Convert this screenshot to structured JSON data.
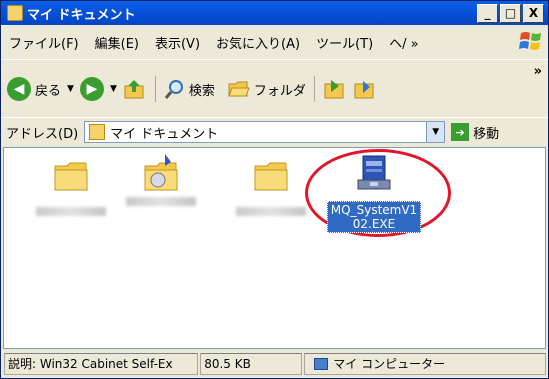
{
  "window": {
    "title": "マイ ドキュメント",
    "buttons": {
      "minimize": "_",
      "maximize": "□",
      "close": "X"
    }
  },
  "menu": [
    "ファイル(F)",
    "編集(E)",
    "表示(V)",
    "お気に入り(A)",
    "ツール(T)",
    "ヘ/ »"
  ],
  "toolbar": {
    "back": "戻る",
    "forward": "",
    "search": "検索",
    "folders": "フォルダ",
    "more": "»"
  },
  "address": {
    "label": "アドレス(D)",
    "value": "マイ ドキュメント",
    "go": "移動"
  },
  "files": [
    {
      "type": "folder"
    },
    {
      "type": "media-folder"
    },
    {
      "type": "folder"
    },
    {
      "type": "exe",
      "label": "MQ_SystemV1\n02.EXE",
      "label_line1": "MQ_SystemV1",
      "label_line2": "02.EXE"
    }
  ],
  "status": {
    "description": "説明: Win32 Cabinet Self-Ex",
    "size": "80.5 KB",
    "zone": "マイ コンピューター"
  },
  "colors": {
    "title_bar": "#0a5ee8",
    "selection": "#316ac5",
    "highlight_ring": "#e0172b",
    "back_button": "#3a9d2f"
  }
}
